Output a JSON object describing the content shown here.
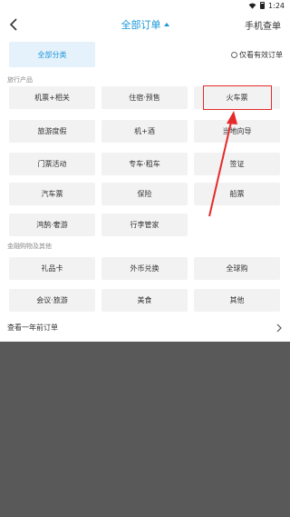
{
  "status_bar": {
    "time": "1:24",
    "icons": [
      "wifi-icon",
      "battery-icon"
    ]
  },
  "nav": {
    "back_icon": "back-arrow-icon",
    "title": "全部订单",
    "right": "手机查单"
  },
  "filter": {
    "category": "全部分类",
    "valid_only": "仅看有效订单"
  },
  "sections": [
    {
      "title": "旅行产品",
      "items": [
        "机票+相关",
        "住宿·预售",
        "火车票",
        "旅游度假",
        "机+酒",
        "当地向导",
        "门票活动",
        "专车·租车",
        "签证",
        "汽车票",
        "保险",
        "船票",
        "鸿鹄·奢游",
        "行李管家"
      ]
    },
    {
      "title": "金融购物及其他",
      "items": [
        "礼品卡",
        "外币兑换",
        "全球购",
        "会议·旅游",
        "美食",
        "其他"
      ]
    }
  ],
  "history_link": "查看一年前订单",
  "colors": {
    "accent": "#1a96d8",
    "highlight": "#e52a2a",
    "overlay": "#595959",
    "button_bg": "#f2f2f2",
    "chip_bg": "#e5f1fb"
  }
}
